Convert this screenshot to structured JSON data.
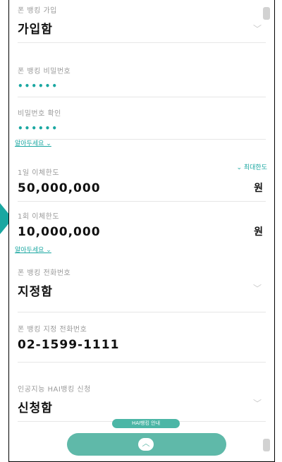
{
  "join": {
    "label": "폰 뱅킹 가입",
    "value": "가입함"
  },
  "password": {
    "label": "폰 뱅킹 비밀번호",
    "masked": "••••••"
  },
  "password_confirm": {
    "label": "비밀번호 확인",
    "masked": "••••••"
  },
  "notice_link_1": "알아두세요 ⌄",
  "daily_limit": {
    "label": "1일 이체한도",
    "value": "50,000,000",
    "unit": "원",
    "max_link": "⌄ 최대한도"
  },
  "single_limit": {
    "label": "1회 이체한도",
    "value": "10,000,000",
    "unit": "원"
  },
  "notice_link_2": "알아두세요 ⌄",
  "phone": {
    "label": "폰 뱅킹 전화번호",
    "value": "지정함"
  },
  "designated_phone": {
    "label": "폰 뱅킹 지정 전화번호",
    "value": "02-1599-1111"
  },
  "ai_banking": {
    "label": "인공지능 HAI뱅킹 신청",
    "value": "신청함"
  },
  "hai_guide_button": "HAI뱅킹 안내",
  "scroll_top_icon": "chevron-up-icon",
  "colors": {
    "accent": "#1aa7a1",
    "button": "#5fb9a9"
  }
}
